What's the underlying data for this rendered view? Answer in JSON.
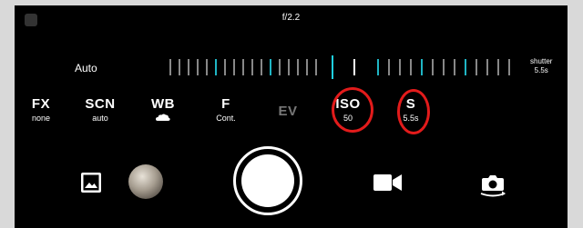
{
  "top": {
    "aperture": "f/2.2"
  },
  "scale": {
    "auto_label": "Auto",
    "readout_label": "shutter",
    "readout_value": "5.5s"
  },
  "modes": {
    "fx": {
      "label": "FX",
      "value": "none"
    },
    "scn": {
      "label": "SCN",
      "value": "auto"
    },
    "wb": {
      "label": "WB",
      "icon": "cloud-icon"
    },
    "f": {
      "label": "F",
      "value": "Cont."
    },
    "ev": {
      "label": "EV"
    },
    "iso": {
      "label": "ISO",
      "value": "50"
    },
    "s": {
      "label": "S",
      "value": "5.5s"
    }
  },
  "bottom": {
    "gallery_icon": "gallery-icon",
    "thumbnail": "last-photo-thumbnail",
    "shutter": "shutter-button",
    "video_icon": "video-camera-icon",
    "switch_icon": "switch-camera-icon"
  },
  "colors": {
    "background": "#000000",
    "accent": "#1fd0e0",
    "annotation": "#e21b1b",
    "disabled": "#777777"
  }
}
